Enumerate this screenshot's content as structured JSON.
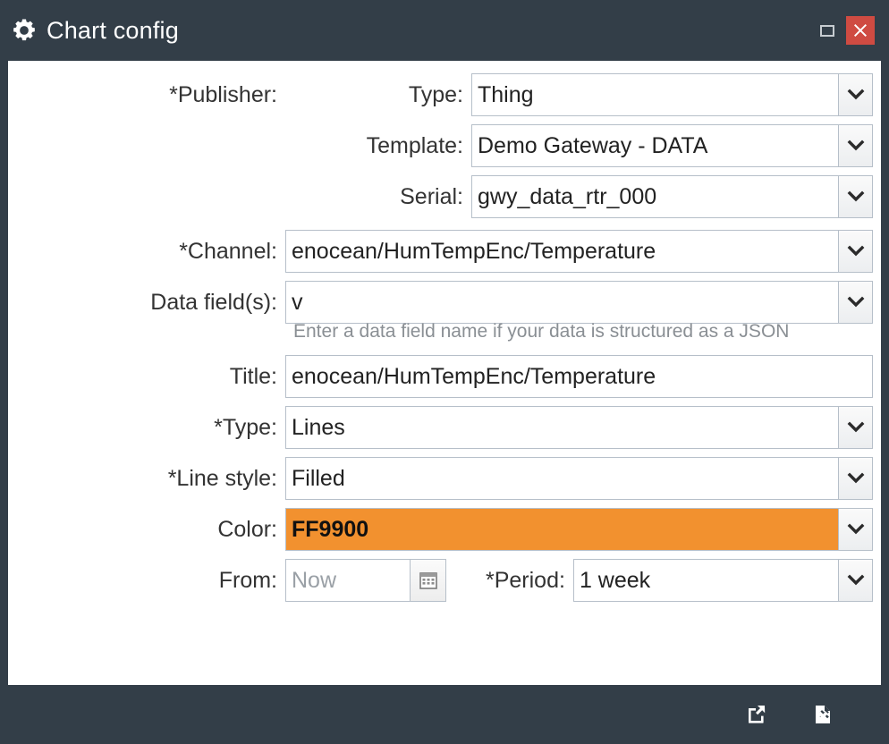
{
  "window": {
    "title": "Chart config",
    "icons": {
      "title_icon": "gear-icon",
      "maximize": "maximize-icon",
      "close": "close-icon"
    },
    "colors": {
      "chrome": "#333e48",
      "close_button": "#cf4b42",
      "color_field_swatch": "#f2912f",
      "field_border": "#b6bfc9"
    }
  },
  "form": {
    "publisher": {
      "label": "*Publisher:",
      "type": {
        "label": "Type:",
        "value": "Thing"
      },
      "template": {
        "label": "Template:",
        "value": "Demo Gateway - DATA"
      },
      "serial": {
        "label": "Serial:",
        "value": "gwy_data_rtr_000"
      }
    },
    "channel": {
      "label": "*Channel:",
      "value": "enocean/HumTempEnc/Temperature"
    },
    "data_fields": {
      "label": "Data field(s):",
      "value": "v",
      "hint": "Enter a data field name if your data is structured as a JSON"
    },
    "title": {
      "label": "Title:",
      "value": "enocean/HumTempEnc/Temperature"
    },
    "type": {
      "label": "*Type:",
      "value": "Lines"
    },
    "line_style": {
      "label": "*Line style:",
      "value": "Filled"
    },
    "color": {
      "label": "Color:",
      "value": "FF9900"
    },
    "from": {
      "label": "From:",
      "value": "",
      "placeholder": "Now",
      "icon": "calendar-icon"
    },
    "period": {
      "label": "*Period:",
      "value": "1 week"
    }
  },
  "footer": {
    "buttons": [
      {
        "name": "export-button",
        "icon": "external-link-icon"
      },
      {
        "name": "delete-button",
        "icon": "file-delete-icon"
      }
    ]
  }
}
